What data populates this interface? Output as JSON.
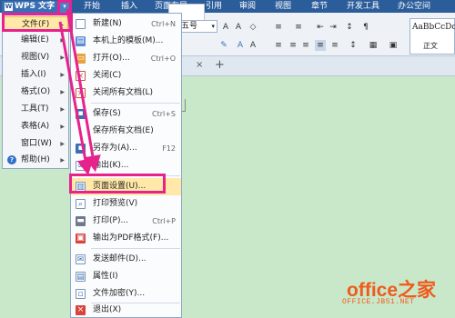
{
  "app": {
    "title": "WPS 文字",
    "logo": "W"
  },
  "tabs": [
    "开始",
    "插入",
    "页面布局",
    "引用",
    "审阅",
    "视图",
    "章节",
    "开发工具",
    "办公空间"
  ],
  "ribbon": {
    "font_size": "五号",
    "style_sample": "AaBbCcDc",
    "style_name": "正文"
  },
  "doctabs": {
    "close": "×",
    "add": "+"
  },
  "main_menu": [
    {
      "label": "文件(F)",
      "selected": true
    },
    {
      "label": "编辑(E)"
    },
    {
      "label": "视图(V)"
    },
    {
      "label": "插入(I)"
    },
    {
      "label": "格式(O)"
    },
    {
      "label": "工具(T)"
    },
    {
      "label": "表格(A)"
    },
    {
      "label": "窗口(W)"
    },
    {
      "label": "帮助(H)"
    }
  ],
  "submenu": [
    {
      "label": "新建(N)",
      "shortcut": "Ctrl+N",
      "icon": "new-doc-icon"
    },
    {
      "label": "本机上的模板(M)...",
      "shortcut": "",
      "icon": "template-icon"
    },
    {
      "label": "打开(O)...",
      "shortcut": "Ctrl+O",
      "icon": "open-folder-icon"
    },
    {
      "label": "关闭(C)",
      "shortcut": "",
      "icon": "close-doc-icon"
    },
    {
      "label": "关闭所有文档(L)",
      "shortcut": "",
      "icon": "close-all-icon"
    },
    {
      "label": "保存(S)",
      "shortcut": "Ctrl+S",
      "icon": "save-icon"
    },
    {
      "label": "保存所有文档(E)",
      "shortcut": "",
      "icon": "save-all-icon"
    },
    {
      "label": "另存为(A)...",
      "shortcut": "F12",
      "icon": "save-as-icon"
    },
    {
      "label": "输出(K)...",
      "shortcut": "",
      "icon": "link-icon"
    },
    {
      "label": "页面设置(U)...",
      "shortcut": "",
      "icon": "page-setup-icon"
    },
    {
      "label": "打印预览(V)",
      "shortcut": "",
      "icon": "print-preview-icon"
    },
    {
      "label": "打印(P)...",
      "shortcut": "Ctrl+P",
      "icon": "print-icon"
    },
    {
      "label": "输出为PDF格式(F)...",
      "shortcut": "",
      "icon": "pdf-icon"
    },
    {
      "label": "发送邮件(D)...",
      "shortcut": "",
      "icon": "mail-icon"
    },
    {
      "label": "属性(I)",
      "shortcut": "",
      "icon": "properties-icon"
    },
    {
      "label": "文件加密(Y)...",
      "shortcut": "",
      "icon": "encrypt-icon"
    },
    {
      "label": "退出(X)",
      "shortcut": "",
      "icon": "exit-icon"
    }
  ],
  "watermark": {
    "brand": "office之家",
    "url": "OFFICE.JB51.NET"
  },
  "colors": {
    "highlight": "#e6238c",
    "title_bar": "#2c5d9b",
    "doc_bg": "#c9e8c9"
  }
}
